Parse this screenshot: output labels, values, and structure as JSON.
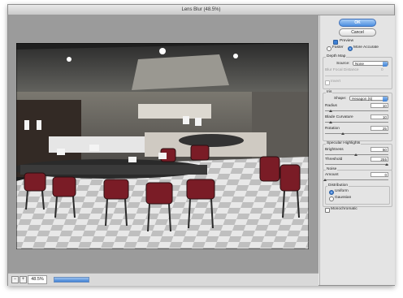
{
  "window": {
    "title": "Lens Blur (48.5%)"
  },
  "buttons": {
    "ok": "OK",
    "cancel": "Cancel"
  },
  "preview": {
    "label": "Preview",
    "checked": true
  },
  "speed": {
    "options": [
      "Faster",
      "More Accurate"
    ],
    "selected": "More Accurate"
  },
  "depth_map": {
    "section": "Depth Map",
    "source_label": "Source:",
    "source_value": "None",
    "blur_focal_label": "Blur Focal Distance",
    "blur_focal_value": "0",
    "invert_label": "Invert"
  },
  "iris": {
    "section": "Iris",
    "shape_label": "Shape:",
    "shape_value": "Hexagon (6)",
    "radius_label": "Radius",
    "radius_value": "10",
    "blade_label": "Blade Curvature",
    "blade_value": "10",
    "rotation_label": "Rotation",
    "rotation_value": "25"
  },
  "specular": {
    "section": "Specular Highlights",
    "brightness_label": "Brightness",
    "brightness_value": "50",
    "threshold_label": "Threshold",
    "threshold_value": "255"
  },
  "noise": {
    "section": "Noise",
    "amount_label": "Amount",
    "amount_value": "0",
    "distribution_label": "Distribution",
    "distribution_options": [
      "Uniform",
      "Gaussian"
    ],
    "distribution_selected": "Uniform",
    "monochromatic_label": "Monochromatic"
  },
  "status": {
    "zoom": "48.5%",
    "zoom_minus": "−",
    "zoom_plus": "+"
  },
  "colors": {
    "accent": "#3d7fd4",
    "panel": "#e4e4e4",
    "preview_bg": "#9b9b9b"
  }
}
